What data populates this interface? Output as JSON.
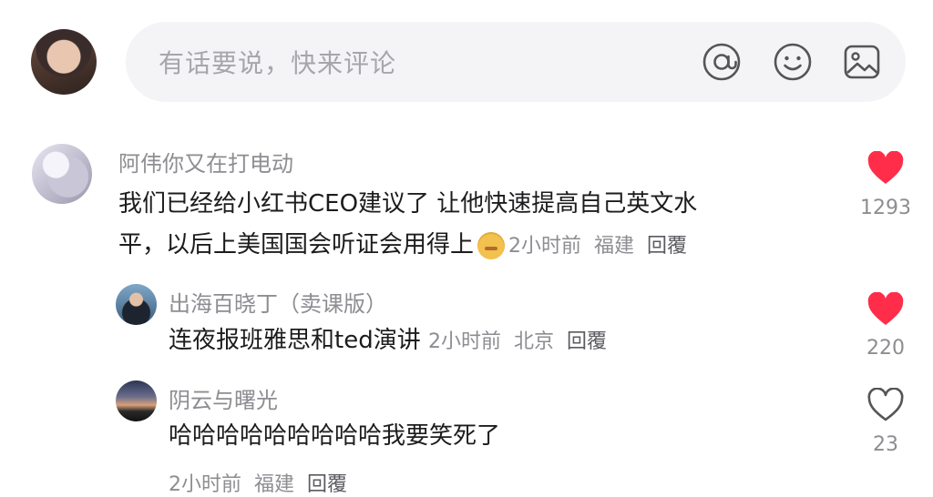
{
  "input": {
    "placeholder": "有话要说，快来评论"
  },
  "icons": {
    "mention": "at-icon",
    "emoji": "smiley-icon",
    "image": "image-icon",
    "like": "heart-icon"
  },
  "colors": {
    "like_active": "#ff2d4a",
    "like_inactive": "#555555"
  },
  "comments": [
    {
      "username": "阿伟你又在打电动",
      "text_line1": "我们已经给小红书CEO建议了 让他快速提高自己英文水",
      "text_line2": "平，以后上美国国会听证会用得上",
      "time": "2小时前",
      "location": "福建",
      "reply": "回覆",
      "likes": "1293",
      "liked": true
    },
    {
      "username": "出海百晓丁（卖课版）",
      "text": "连夜报班雅思和ted演讲",
      "time": "2小时前",
      "location": "北京",
      "reply": "回覆",
      "likes": "220",
      "liked": true
    },
    {
      "username": "阴云与曙光",
      "text": "哈哈哈哈哈哈哈哈哈我要笑死了",
      "time": "2小时前",
      "location": "福建",
      "reply": "回覆",
      "likes": "23",
      "liked": false
    }
  ]
}
